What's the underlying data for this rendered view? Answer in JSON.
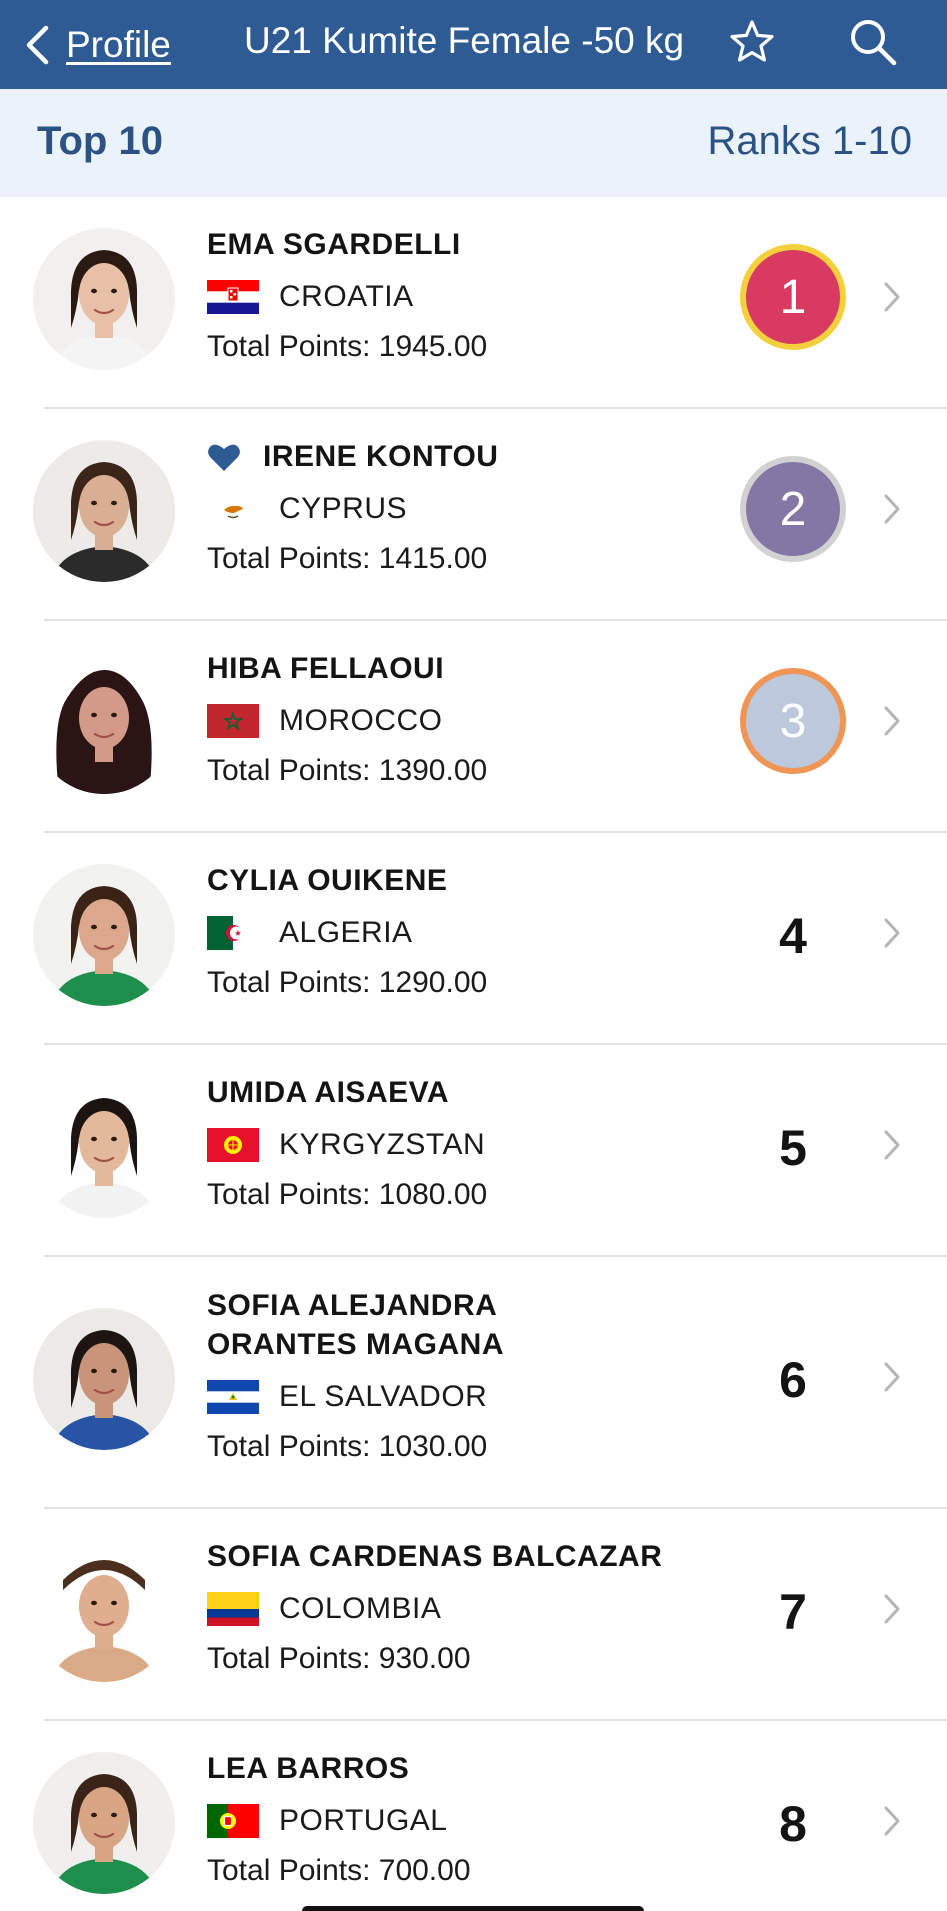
{
  "nav": {
    "back_label": "Profile",
    "title": "U21 Kumite Female -50 kg",
    "icons": [
      "chevron-left-icon",
      "star-icon",
      "search-icon"
    ]
  },
  "subheader": {
    "left": "Top 10",
    "right": "Ranks 1-10"
  },
  "colors": {
    "nav_bg": "#2e5b94",
    "subheader_bg": "#eaf3fc",
    "accent_text": "#2c5283",
    "gold_medal": "#d83a61",
    "silver_medal": "#8477a5",
    "bronze_medal": "#bcc9dc"
  },
  "athletes": [
    {
      "rank": "1",
      "name": "EMA SGARDELLI",
      "country": "CROATIA",
      "points": "Total Points: 1945.00",
      "favorite": false,
      "medal": "gold"
    },
    {
      "rank": "2",
      "name": "IRENE KONTOU",
      "country": "CYPRUS",
      "points": "Total Points: 1415.00",
      "favorite": true,
      "medal": "silver"
    },
    {
      "rank": "3",
      "name": "HIBA FELLAOUI",
      "country": "MOROCCO",
      "points": "Total Points: 1390.00",
      "favorite": false,
      "medal": "bronze"
    },
    {
      "rank": "4",
      "name": "CYLIA OUIKENE",
      "country": "ALGERIA",
      "points": "Total Points: 1290.00",
      "favorite": false,
      "medal": null
    },
    {
      "rank": "5",
      "name": "UMIDA AISAEVA",
      "country": "KYRGYZSTAN",
      "points": "Total Points: 1080.00",
      "favorite": false,
      "medal": null
    },
    {
      "rank": "6",
      "name": "SOFIA ALEJANDRA ORANTES MAGANA",
      "country": "EL SALVADOR",
      "points": "Total Points: 1030.00",
      "favorite": false,
      "medal": null
    },
    {
      "rank": "7",
      "name": "SOFIA CARDENAS BALCAZAR",
      "country": "COLOMBIA",
      "points": "Total Points: 930.00",
      "favorite": false,
      "medal": null
    },
    {
      "rank": "8",
      "name": "LEA BARROS",
      "country": "PORTUGAL",
      "points": "Total Points: 700.00",
      "favorite": false,
      "medal": null
    }
  ]
}
